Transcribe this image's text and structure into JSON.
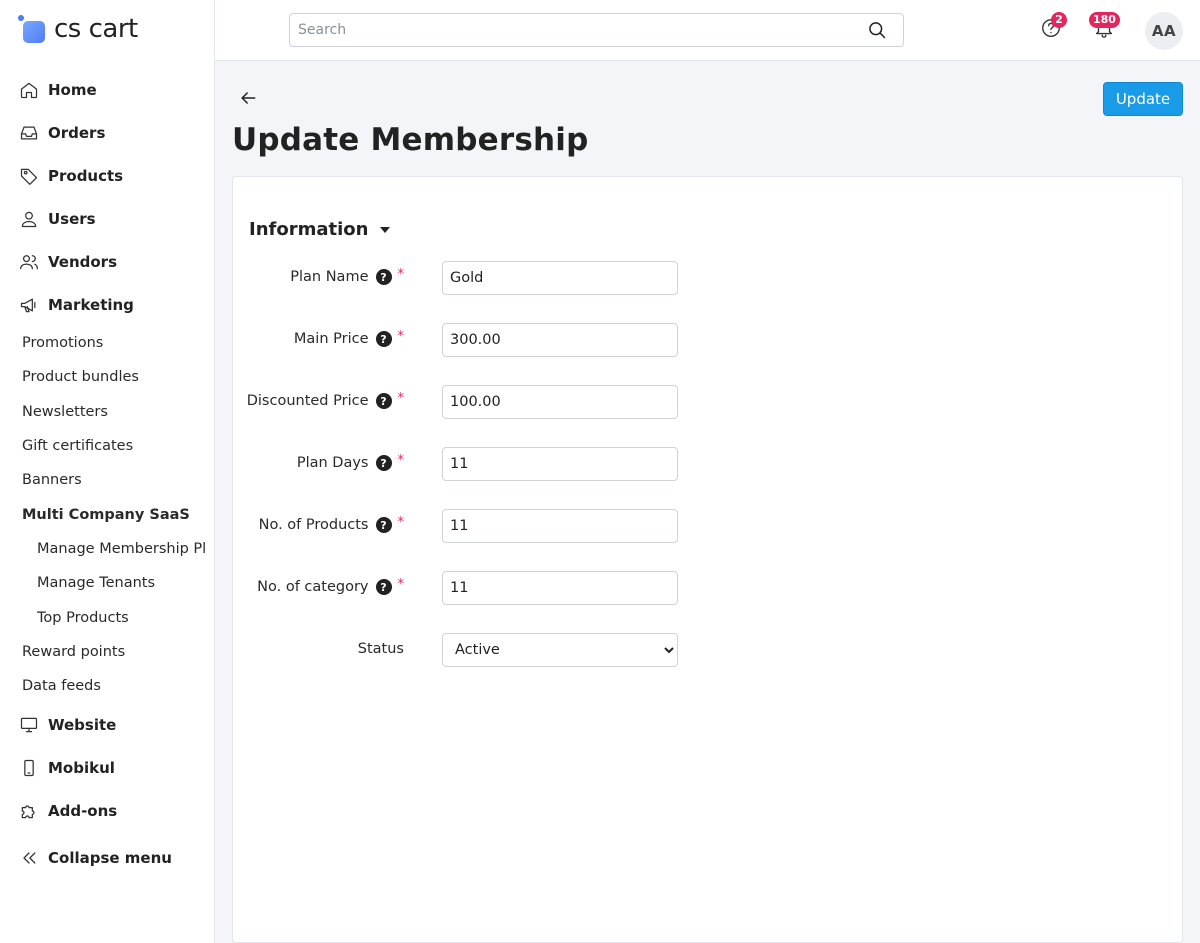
{
  "brand": {
    "name": "cs cart",
    "accent": "#4f7cf5"
  },
  "search": {
    "placeholder": "Search"
  },
  "topbar": {
    "help_badge": "2",
    "notifications_badge": "180",
    "avatar_initials": "AA"
  },
  "sidebar": {
    "items": [
      {
        "label": "Home",
        "icon": "home-icon"
      },
      {
        "label": "Orders",
        "icon": "inbox-icon"
      },
      {
        "label": "Products",
        "icon": "tag-icon"
      },
      {
        "label": "Users",
        "icon": "user-icon"
      },
      {
        "label": "Vendors",
        "icon": "users-icon"
      },
      {
        "label": "Marketing",
        "icon": "megaphone-icon"
      }
    ],
    "marketing_sub": [
      "Promotions",
      "Product bundles",
      "Newsletters",
      "Gift certificates",
      "Banners"
    ],
    "saas_group": "Multi Company SaaS",
    "saas_sub": [
      "Manage Membership Plans",
      "Manage Tenants",
      "Top Products"
    ],
    "marketing_sub_after": [
      "Reward points",
      "Data feeds"
    ],
    "items_after": [
      {
        "label": "Website",
        "icon": "monitor-icon"
      },
      {
        "label": "Mobikul",
        "icon": "phone-icon"
      },
      {
        "label": "Add-ons",
        "icon": "puzzle-icon"
      }
    ],
    "collapse_label": "Collapse menu"
  },
  "page": {
    "title": "Update Membership",
    "update_label": "Update",
    "section_title": "Information"
  },
  "form": {
    "plan_name": {
      "label": "Plan Name",
      "value": "Gold"
    },
    "main_price": {
      "label": "Main Price",
      "value": "300.00"
    },
    "discounted_price": {
      "label": "Discounted Price",
      "value": "100.00"
    },
    "plan_days": {
      "label": "Plan Days",
      "value": "11"
    },
    "no_products": {
      "label": "No. of Products",
      "value": "11"
    },
    "no_category": {
      "label": "No. of category",
      "value": "11"
    },
    "status": {
      "label": "Status",
      "value": "Active",
      "options": [
        "Active"
      ]
    }
  },
  "colors": {
    "primary_button": "#1a9be8",
    "required": "#e6255f",
    "badge": "#e6255f"
  }
}
